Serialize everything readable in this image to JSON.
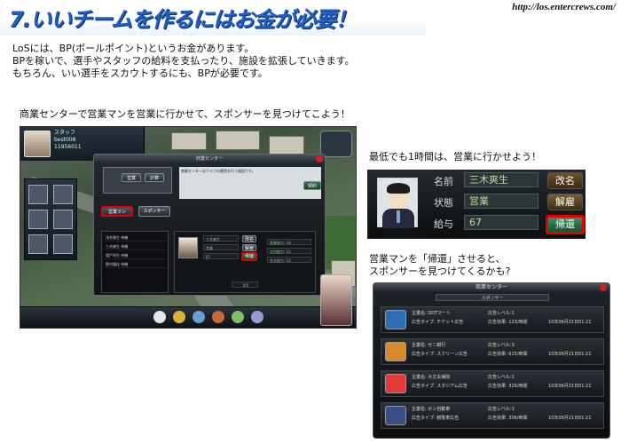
{
  "header": {
    "title": "7.いいチームを作るにはお金が必要！",
    "url": "http://los.entercrews.com/"
  },
  "intro": [
    "LoSには、BP(ボールポイント)というお金があります。",
    "BPを稼いで、選手やスタッフの給料を支払ったり、施設を拡張していきます。",
    "もちろん、いい選手をスカウトするにも、BPが必要です。"
  ],
  "caption_left": "商業センターで営業マンを営業に行かせて、スポンサーを見つけてこよう！",
  "caption_right_top": "最低でも1時間は、営業に行かせよう！",
  "caption_right_mid": [
    "営業マンを「帰還」させると、",
    "スポンサーを見つけてくるかも?"
  ],
  "game": {
    "hud_name": "スタッフ\nbest008\n11956011",
    "dialog_title": "商業センター",
    "info_text": "商業センターはクラブの運営を行う施設です。",
    "buttons": [
      "営業",
      "計算",
      "契約"
    ],
    "tabs": [
      "営業マン",
      "スポンサー"
    ],
    "staff_list": [
      "浅井康生",
      "三木爽生",
      "増戸利生",
      "野村優佳",
      ""
    ],
    "list_status": [
      "待機",
      "待機",
      "待機",
      "待機",
      ""
    ],
    "detail": {
      "name_label": "名前",
      "name_value": "三木爽生",
      "state_label": "状態",
      "state_value": "営業",
      "pay_label": "給与",
      "pay_value": "67",
      "btn_rename": "改名",
      "btn_dispatch": "解雇",
      "btn_return": "帰還",
      "stats": [
        "営業能力: 18",
        "交渉能力: 15",
        "社交能力: 12"
      ],
      "page": "0/5"
    }
  },
  "staff_panel": {
    "name_label": "名前",
    "name_value": "三木爽生",
    "state_label": "状態",
    "state_value": "営業",
    "pay_label": "給与",
    "pay_value": "67",
    "btn_rename": "改名",
    "btn_fire": "解雇",
    "btn_return": "帰還"
  },
  "sponsor_panel": {
    "title": "商業センター",
    "subtitle": "スポンサー",
    "rows": [
      {
        "name": "企業名:  DDTマート",
        "type": "広告タイプ: チケット広告",
        "level": "広告レベル:1",
        "value": "広告効果:  123/時間",
        "date": "10年06月21日01:21",
        "color": "#2d6fb5"
      },
      {
        "name": "企業名:  ゼニ銀行",
        "type": "広告タイプ: スクリーン広告",
        "level": "広告レベル:3",
        "value": "広告効果:  615/時間",
        "date": "10年06月21日01:21",
        "color": "#d48b2a"
      },
      {
        "name": "企業名:  大丈夫病院",
        "type": "広告タイプ: スタジアム広告",
        "level": "広告レベル:1",
        "value": "広告効果:  326/時間",
        "date": "10年06月21日01:21",
        "color": "#e23838"
      },
      {
        "name": "企業名:  ボン自動車",
        "type": "広告タイプ: 観覧車広告",
        "level": "広告レベル:1",
        "value": "広告効果:  306/時間",
        "date": "10年06月21日01:21",
        "color": "#3a4f8a"
      }
    ]
  }
}
